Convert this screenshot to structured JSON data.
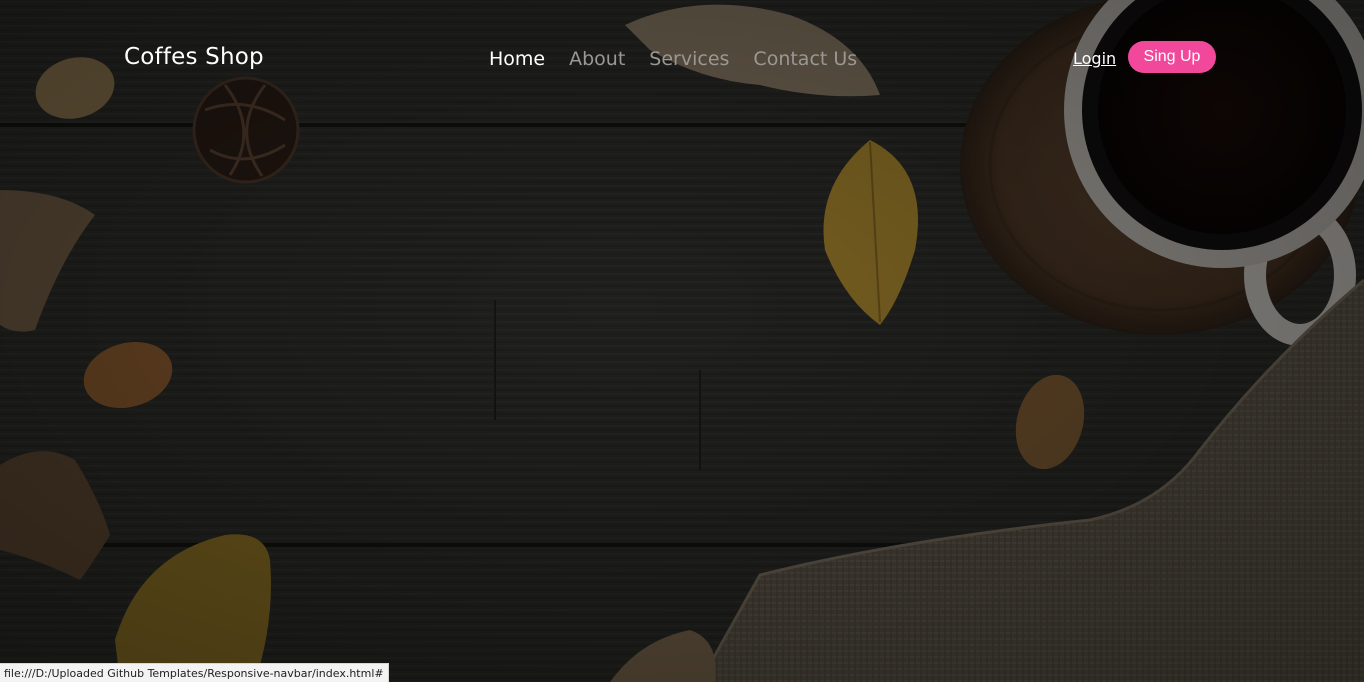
{
  "navbar": {
    "brand": "Coffes Shop",
    "links": [
      {
        "label": "Home",
        "active": true
      },
      {
        "label": "About",
        "active": false
      },
      {
        "label": "Services",
        "active": false
      },
      {
        "label": "Contact Us",
        "active": false
      }
    ],
    "login_label": "Login",
    "signup_label": "Sing Up"
  },
  "status_bar": {
    "url": "file:///D:/Uploaded Github Templates/Responsive-navbar/index.html#"
  },
  "colors": {
    "accent": "#f2489c",
    "text": "#ffffff",
    "muted_link": "#9b9793",
    "background": "#2a2a28"
  },
  "icons": {
    "background": "hero-background-image"
  }
}
